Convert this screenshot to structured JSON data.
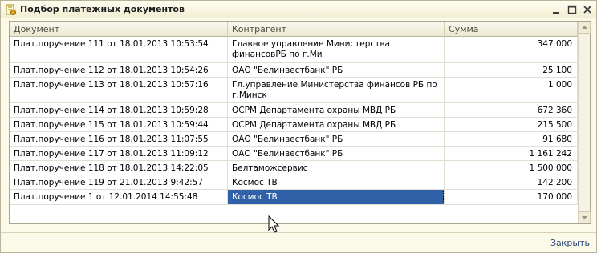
{
  "window": {
    "title": "Подбор платежных документов"
  },
  "grid": {
    "columns": [
      "Документ",
      "Контрагент",
      "Сумма"
    ],
    "rows": [
      {
        "doc": "Плат.поручение 111 от 18.01.2013 10:53:54",
        "contractor": "Главное управление Министерства финансовРБ по г.Ми",
        "sum": "347 000"
      },
      {
        "doc": "Плат.поручение 112 от 18.01.2013 10:54:26",
        "contractor": "ОАО \"Белинвестбанк\" РБ",
        "sum": "25 100"
      },
      {
        "doc": "Плат.поручение 113 от 18.01.2013 10:57:16",
        "contractor": "Гл.управление Министерства финансов РБ  по г.Минск",
        "sum": "1 000"
      },
      {
        "doc": "Плат.поручение 114 от 18.01.2013 10:59:28",
        "contractor": "ОСРМ Департамента охраны МВД РБ",
        "sum": "672 360"
      },
      {
        "doc": "Плат.поручение 115 от 18.01.2013 10:59:44",
        "contractor": "ОСРМ Департамента охраны МВД РБ",
        "sum": "215 500"
      },
      {
        "doc": "Плат.поручение 116 от 18.01.2013 11:07:55",
        "contractor": "ОАО \"Белинвестбанк\" РБ",
        "sum": "91 680"
      },
      {
        "doc": "Плат.поручение 117 от 18.01.2013 11:09:12",
        "contractor": "ОАО \"Белинвестбанк\" РБ",
        "sum": "1 161 242"
      },
      {
        "doc": "Плат.поручение 118 от 18.01.2013 14:22:05",
        "contractor": "Белтаможсервис",
        "sum": "1 500 000"
      },
      {
        "doc": "Плат.поручение 119 от 21.01.2013 9:42:57",
        "contractor": "Космос ТВ",
        "sum": "142 200"
      },
      {
        "doc": "Плат.поручение 1 от 12.01.2014 14:55:48",
        "contractor": "Космос ТВ",
        "sum": "170 000"
      }
    ]
  },
  "footer": {
    "close_label": "Закрыть"
  },
  "colors": {
    "selection": "#3060a8",
    "window_bg": "#fbf9e8",
    "link": "#2c4b7c"
  }
}
